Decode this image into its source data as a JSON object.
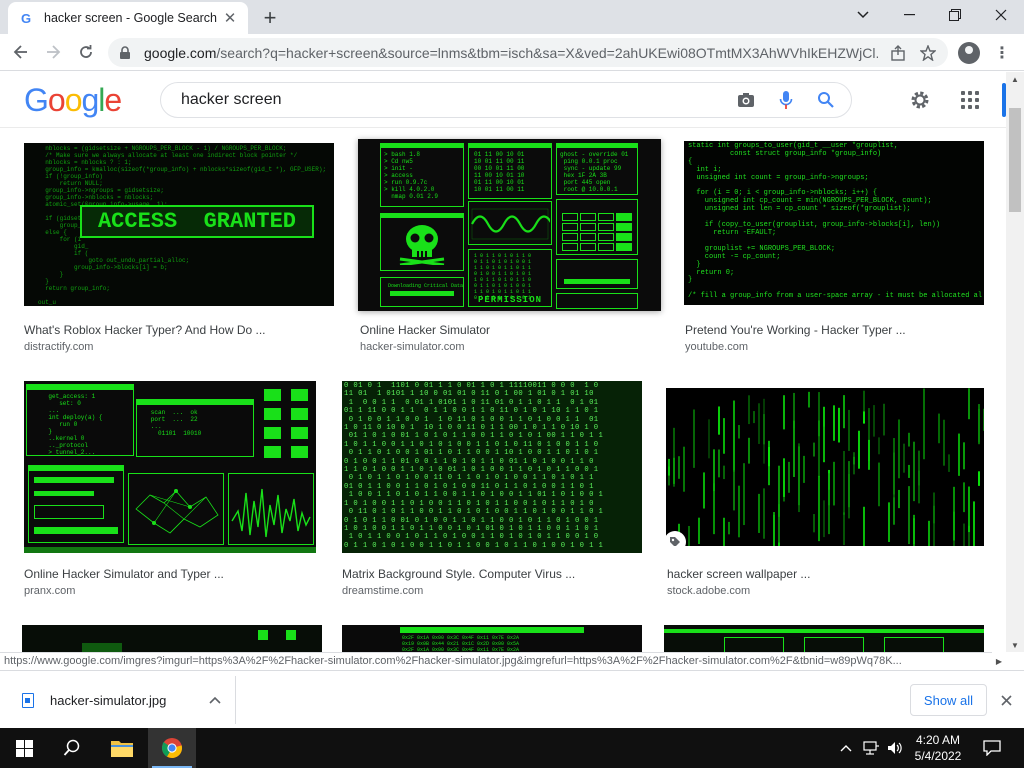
{
  "tab": {
    "favicon": "G",
    "title": "hacker screen - Google Search"
  },
  "window": {
    "minimize": "⌄"
  },
  "address": {
    "host": "google.com",
    "path": "/search?q=hacker+screen&source=lnms&tbm=isch&sa=X&ved=2ahUKEwi08OTmtMX3AhWVhIkEHZWjCl..."
  },
  "google": {
    "logo": [
      {
        "ch": "G",
        "color": "#4285f4"
      },
      {
        "ch": "o",
        "color": "#ea4335"
      },
      {
        "ch": "o",
        "color": "#fbbc05"
      },
      {
        "ch": "g",
        "color": "#4285f4"
      },
      {
        "ch": "l",
        "color": "#34a853"
      },
      {
        "ch": "e",
        "color": "#ea4335"
      }
    ],
    "query": "hacker screen"
  },
  "results": [
    {
      "title": "What's Roblox Hacker Typer? And How Do ...",
      "source": "distractify.com",
      "overlay_text": "ACCESS  GRANTED"
    },
    {
      "title": "Online Hacker Simulator",
      "source": "hacker-simulator.com",
      "overlay_text": "PERMISSION",
      "overlay_text2": "Downloading Critical Data"
    },
    {
      "title": "Pretend You're Working - Hacker Typer ...",
      "source": "youtube.com",
      "code_lines": [
        "static int groups_to_user(gid_t __user *grouplist,",
        "          const struct group_info *group_info)",
        "{",
        "  int i;",
        "  unsigned int count = group_info->ngroups;",
        "",
        "  for (i = 0; i < group_info->nblocks; i++) {",
        "    unsigned int cp_count = min(NGROUPS_PER_BLOCK, count);",
        "    unsigned int len = cp_count * sizeof(*grouplist);",
        "",
        "    if (copy_to_user(grouplist, group_info->blocks[i], len))",
        "      return -EFAULT;",
        "",
        "    grouplist += NGROUPS_PER_BLOCK;",
        "    count -= cp_count;",
        "  }",
        "  return 0;",
        "}",
        "",
        "/* fill a group_info from a user-space array - it must be allocated al"
      ]
    },
    {
      "title": "Online Hacker Simulator and Typer ...",
      "source": "pranx.com"
    },
    {
      "title": "Matrix Background Style. Computer Virus ...",
      "source": "dreamstime.com"
    },
    {
      "title": "hacker screen wallpaper ...",
      "source": "stock.adobe.com"
    },
    {
      "title": "",
      "source": ""
    },
    {
      "title": "",
      "source": ""
    },
    {
      "title": "",
      "source": ""
    }
  ],
  "status_url": "https://www.google.com/imgres?imgurl=https%3A%2F%2Fhacker-simulator.com%2Fhacker-simulator.jpg&imgrefurl=https%3A%2F%2Fhacker-simulator.com%2F&tbnid=w89pWq78K...",
  "download": {
    "filename": "hacker-simulator.jpg",
    "show_all": "Show all"
  },
  "taskbar": {
    "time": "4:20 AM",
    "date": "5/4/2022"
  },
  "colors": {
    "accent": "#1a73e8",
    "hacker_green": "#19e019"
  }
}
